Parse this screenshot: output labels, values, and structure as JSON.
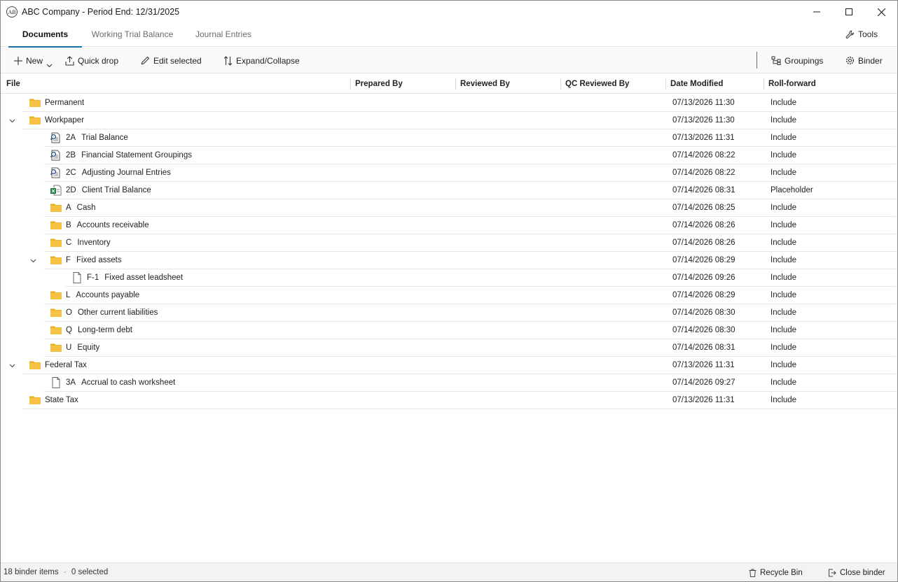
{
  "window": {
    "title": "ABC Company - Period End: 12/31/2025",
    "app_icon_text": "AB"
  },
  "tabs": [
    {
      "label": "Documents",
      "active": true
    },
    {
      "label": "Working Trial Balance",
      "active": false
    },
    {
      "label": "Journal Entries",
      "active": false
    }
  ],
  "tools_label": "Tools",
  "toolbar": {
    "new_label": "New",
    "quick_drop_label": "Quick drop",
    "edit_selected_label": "Edit selected",
    "expand_collapse_label": "Expand/Collapse",
    "groupings_label": "Groupings",
    "binder_label": "Binder"
  },
  "columns": {
    "file": "File",
    "prepared_by": "Prepared By",
    "reviewed_by": "Reviewed By",
    "qc_reviewed_by": "QC Reviewed By",
    "date_modified": "Date Modified",
    "roll_forward": "Roll-forward"
  },
  "rows": [
    {
      "level": 0,
      "expanded": null,
      "icon": "folder-icon",
      "code": "",
      "name": "Permanent",
      "date": "07/13/2026 11:30",
      "roll": "Include"
    },
    {
      "level": 0,
      "expanded": true,
      "icon": "folder-icon",
      "code": "",
      "name": "Workpaper",
      "date": "07/13/2026 11:30",
      "roll": "Include"
    },
    {
      "level": 1,
      "expanded": null,
      "icon": "report-document-icon",
      "code": "2A",
      "name": "Trial Balance",
      "date": "07/13/2026 11:31",
      "roll": "Include"
    },
    {
      "level": 1,
      "expanded": null,
      "icon": "report-document-icon",
      "code": "2B",
      "name": "Financial Statement Groupings",
      "date": "07/14/2026 08:22",
      "roll": "Include"
    },
    {
      "level": 1,
      "expanded": null,
      "icon": "report-document-icon",
      "code": "2C",
      "name": "Adjusting Journal Entries",
      "date": "07/14/2026 08:22",
      "roll": "Include"
    },
    {
      "level": 1,
      "expanded": null,
      "icon": "excel-file-icon",
      "code": "2D",
      "name": "Client Trial Balance",
      "date": "07/14/2026 08:31",
      "roll": "Placeholder"
    },
    {
      "level": 1,
      "expanded": null,
      "icon": "folder-icon",
      "code": "A",
      "name": "Cash",
      "date": "07/14/2026 08:25",
      "roll": "Include"
    },
    {
      "level": 1,
      "expanded": null,
      "icon": "folder-icon",
      "code": "B",
      "name": "Accounts receivable",
      "date": "07/14/2026 08:26",
      "roll": "Include"
    },
    {
      "level": 1,
      "expanded": null,
      "icon": "folder-icon",
      "code": "C",
      "name": "Inventory",
      "date": "07/14/2026 08:26",
      "roll": "Include"
    },
    {
      "level": 1,
      "expanded": true,
      "icon": "folder-icon",
      "code": "F",
      "name": "Fixed assets",
      "date": "07/14/2026 08:29",
      "roll": "Include"
    },
    {
      "level": 2,
      "expanded": null,
      "icon": "blank-file-icon",
      "code": "F-1",
      "name": "Fixed asset leadsheet",
      "date": "07/14/2026 09:26",
      "roll": "Include"
    },
    {
      "level": 1,
      "expanded": null,
      "icon": "folder-icon",
      "code": "L",
      "name": "Accounts payable",
      "date": "07/14/2026 08:29",
      "roll": "Include"
    },
    {
      "level": 1,
      "expanded": null,
      "icon": "folder-icon",
      "code": "O",
      "name": "Other current liabilities",
      "date": "07/14/2026 08:30",
      "roll": "Include"
    },
    {
      "level": 1,
      "expanded": null,
      "icon": "folder-icon",
      "code": "Q",
      "name": "Long-term debt",
      "date": "07/14/2026 08:30",
      "roll": "Include"
    },
    {
      "level": 1,
      "expanded": null,
      "icon": "folder-icon",
      "code": "U",
      "name": "Equity",
      "date": "07/14/2026 08:31",
      "roll": "Include"
    },
    {
      "level": 0,
      "expanded": true,
      "icon": "folder-icon",
      "code": "",
      "name": "Federal Tax",
      "date": "07/13/2026 11:31",
      "roll": "Include"
    },
    {
      "level": 1,
      "expanded": null,
      "icon": "blank-file-icon",
      "code": "3A",
      "name": "Accrual to cash worksheet",
      "date": "07/14/2026 09:27",
      "roll": "Include"
    },
    {
      "level": 0,
      "expanded": null,
      "icon": "folder-icon",
      "code": "",
      "name": "State Tax",
      "date": "07/13/2026 11:31",
      "roll": "Include"
    }
  ],
  "status": {
    "count_text": "18 binder items",
    "separator": "·",
    "selected_text": "0 selected",
    "recycle_bin_label": "Recycle Bin",
    "close_binder_label": "Close binder"
  },
  "colors": {
    "accent": "#1d6fa5",
    "folder": "#f6c244",
    "folder_dark": "#e3a91f"
  }
}
